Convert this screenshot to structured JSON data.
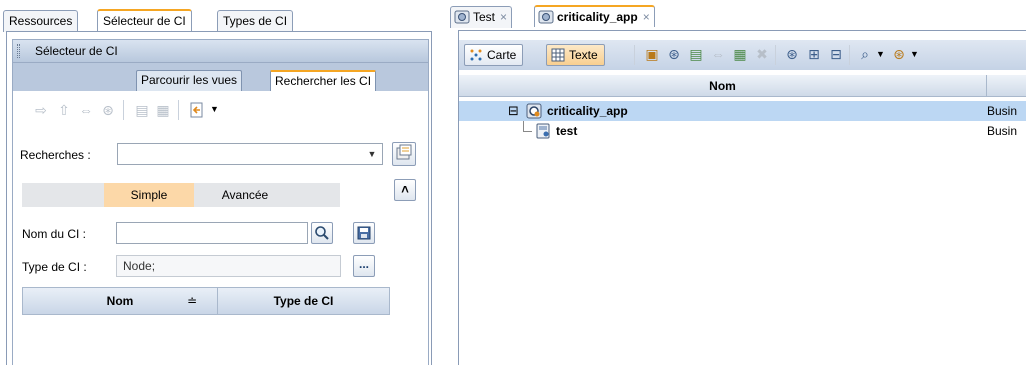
{
  "left": {
    "tabs": [
      "Ressources",
      "Sélecteur de CI",
      "Types de CI"
    ],
    "panel_title": "Sélecteur de CI",
    "subtabs": [
      "Parcourir les vues",
      "Rechercher les CI"
    ],
    "searches_label": "Recherches :",
    "searches_value": "",
    "mode_tabs": [
      "Simple",
      "Avancée"
    ],
    "ci_name_label": "Nom du CI :",
    "ci_name_value": "",
    "ci_type_label": "Type de CI :",
    "ci_type_value": "Node;",
    "browse_button": "...",
    "table_headers": [
      "Nom",
      "Type de CI"
    ],
    "collapse_glyph": "˄"
  },
  "right": {
    "tabs": [
      {
        "label": "Test",
        "close": "×"
      },
      {
        "label": "criticality_app",
        "close": "×"
      }
    ],
    "view_buttons": [
      "Carte",
      "Texte"
    ],
    "table_headers": [
      "Nom"
    ],
    "rows": [
      {
        "name": "criticality_app",
        "type": "Busin",
        "expand": "⊟"
      },
      {
        "name": "test",
        "type": "Busin"
      }
    ]
  },
  "colors": {
    "accent": "#f5a623",
    "selection": "#bcd7f3",
    "header": "#c5d3e6"
  }
}
